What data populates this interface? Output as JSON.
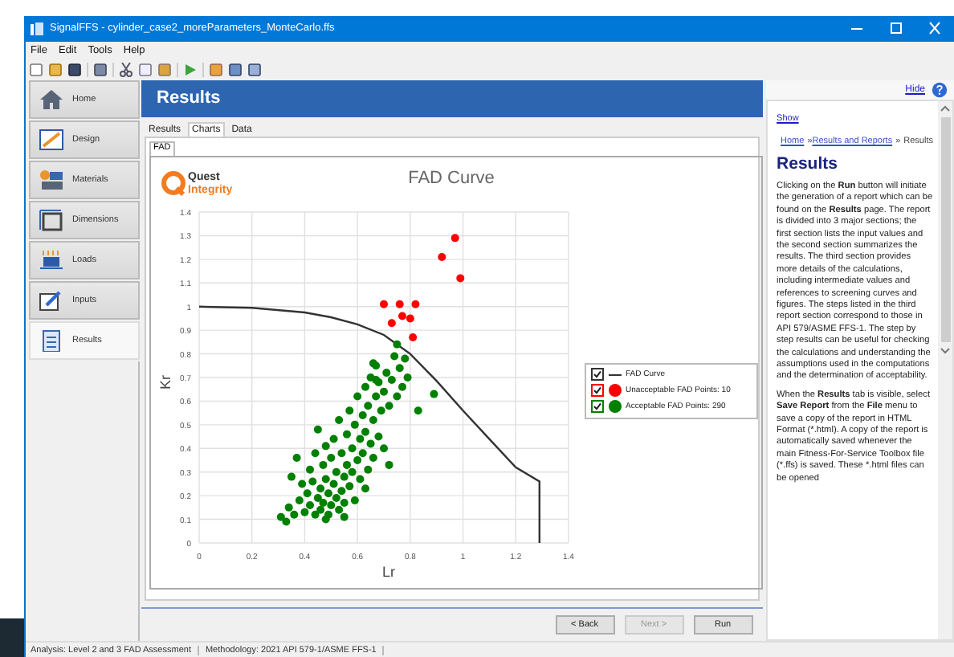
{
  "window": {
    "title": "SignalFFS  -  cylinder_case2_moreParameters_MonteCarlo.ffs"
  },
  "menu": [
    "File",
    "Edit",
    "Tools",
    "Help"
  ],
  "toolbar": [
    {
      "kind": "new"
    },
    {
      "kind": "open"
    },
    {
      "kind": "save"
    },
    {
      "kind": "sep"
    },
    {
      "kind": "print"
    },
    {
      "kind": "sep"
    },
    {
      "kind": "cut"
    },
    {
      "kind": "copy"
    },
    {
      "kind": "paste"
    },
    {
      "kind": "sep"
    },
    {
      "kind": "run"
    },
    {
      "kind": "sep"
    },
    {
      "kind": "report"
    },
    {
      "kind": "chart"
    },
    {
      "kind": "preview"
    }
  ],
  "sidebar": {
    "items": [
      {
        "label": "Home",
        "kind": "home",
        "selected": false
      },
      {
        "label": "Design",
        "kind": "design",
        "selected": false
      },
      {
        "label": "Materials",
        "kind": "materials",
        "selected": false
      },
      {
        "label": "Dimensions",
        "kind": "dimensions",
        "selected": false
      },
      {
        "label": "Loads",
        "kind": "loads",
        "selected": false
      },
      {
        "label": "Inputs",
        "kind": "inputs",
        "selected": false
      },
      {
        "label": "Results",
        "kind": "results",
        "selected": true
      }
    ]
  },
  "page": {
    "title": "Results",
    "tabs": [
      {
        "label": "Results",
        "selected": false
      },
      {
        "label": "Charts",
        "selected": true
      },
      {
        "label": "Data",
        "selected": false
      }
    ],
    "subtabs": [
      {
        "label": "FAD",
        "selected": true
      }
    ],
    "logo": {
      "line1": "Quest",
      "line2": "Integrity"
    },
    "chart_data": {
      "type": "scatter",
      "grid": true,
      "legend": "right",
      "title": "FAD Curve",
      "xlabel": "Lr",
      "ylabel": "Kr",
      "xlim": [
        0,
        1.4
      ],
      "ylim": [
        0,
        1.4
      ],
      "xticks": [
        0,
        0.2,
        0.4,
        0.6,
        0.8,
        1,
        1.2,
        1.4
      ],
      "yticks": [
        0,
        0.1,
        0.2,
        0.3,
        0.4,
        0.5,
        0.6,
        0.7,
        0.8,
        0.9,
        1,
        1.1,
        1.2,
        1.3,
        1.4
      ],
      "series": [
        {
          "name": "FAD Curve",
          "type": "line",
          "color": "#333333",
          "x": [
            0,
            0.2,
            0.4,
            0.5,
            0.6,
            0.7,
            0.8,
            0.9,
            1,
            1.1,
            1.2,
            1.29,
            1.29
          ],
          "values": [
            1,
            0.995,
            0.975,
            0.955,
            0.925,
            0.88,
            0.8,
            0.685,
            0.56,
            0.44,
            0.32,
            0.26,
            0
          ]
        },
        {
          "name": "Unacceptable FAD Points: 10",
          "color": "#ff0000",
          "x": [
            0.7,
            0.76,
            0.82,
            0.73,
            0.77,
            0.8,
            0.81,
            0.92,
            0.97,
            0.99
          ],
          "values": [
            1.01,
            1.01,
            1.01,
            0.93,
            0.96,
            0.95,
            0.87,
            1.21,
            1.29,
            1.12
          ]
        },
        {
          "name": "Acceptable FAD Points: 290",
          "color": "#008000",
          "x": [
            0.31,
            0.33,
            0.34,
            0.36,
            0.35,
            0.37,
            0.38,
            0.39,
            0.4,
            0.41,
            0.42,
            0.42,
            0.43,
            0.44,
            0.44,
            0.45,
            0.45,
            0.46,
            0.46,
            0.47,
            0.47,
            0.48,
            0.48,
            0.49,
            0.49,
            0.5,
            0.5,
            0.51,
            0.51,
            0.52,
            0.52,
            0.53,
            0.53,
            0.54,
            0.54,
            0.55,
            0.55,
            0.56,
            0.56,
            0.57,
            0.57,
            0.58,
            0.58,
            0.59,
            0.59,
            0.6,
            0.6,
            0.61,
            0.61,
            0.62,
            0.62,
            0.63,
            0.63,
            0.64,
            0.64,
            0.65,
            0.65,
            0.66,
            0.66,
            0.67,
            0.67,
            0.68,
            0.68,
            0.69,
            0.7,
            0.7,
            0.71,
            0.72,
            0.72,
            0.73,
            0.74,
            0.75,
            0.75,
            0.76,
            0.77,
            0.78,
            0.79,
            0.83,
            0.89,
            0.66,
            0.67,
            0.55,
            0.48,
            0.63
          ],
          "values": [
            0.11,
            0.09,
            0.15,
            0.12,
            0.28,
            0.36,
            0.18,
            0.25,
            0.13,
            0.21,
            0.31,
            0.16,
            0.26,
            0.12,
            0.38,
            0.19,
            0.48,
            0.23,
            0.14,
            0.33,
            0.17,
            0.27,
            0.41,
            0.12,
            0.21,
            0.16,
            0.36,
            0.25,
            0.44,
            0.19,
            0.3,
            0.14,
            0.52,
            0.22,
            0.38,
            0.28,
            0.17,
            0.46,
            0.33,
            0.24,
            0.56,
            0.4,
            0.3,
            0.18,
            0.5,
            0.35,
            0.62,
            0.44,
            0.27,
            0.54,
            0.38,
            0.66,
            0.47,
            0.31,
            0.58,
            0.42,
            0.7,
            0.52,
            0.36,
            0.62,
            0.75,
            0.45,
            0.68,
            0.56,
            0.64,
            0.4,
            0.72,
            0.33,
            0.58,
            0.69,
            0.79,
            0.62,
            0.84,
            0.74,
            0.66,
            0.78,
            0.7,
            0.56,
            0.63,
            0.76,
            0.69,
            0.11,
            0.1,
            0.23
          ]
        }
      ]
    },
    "legend": [
      {
        "checked": true
      },
      {
        "checked": true
      },
      {
        "checked": true
      }
    ],
    "buttons": [
      {
        "label": "< Back",
        "disabled": false
      },
      {
        "label": "Next >",
        "disabled": true
      },
      {
        "label": "Run",
        "disabled": false
      }
    ]
  },
  "help": {
    "hide_link": "Hide",
    "show_link": "Show",
    "breadcrumb": [
      "Home",
      "Results and Reports",
      "Results"
    ],
    "separator": "»",
    "title": "Results",
    "paragraphs": [
      [
        {
          "text": "Clicking on the "
        },
        {
          "text": "Run",
          "bold": true
        },
        {
          "text": " button will initiate the generation of a report which can be found on the "
        },
        {
          "text": "Results",
          "bold": true
        },
        {
          "text": " page. The report is divided into 3 major sections; the first section lists the input values and the second section summarizes the results. The third section provides more details of the calculations, including intermediate values and references to screening curves and figures. The steps listed in the third report section correspond to those in API 579/ASME FFS-1. The step by step results can be useful for checking the calculations and understanding the assumptions used in the computations and the determination of acceptability."
        }
      ],
      [
        {
          "text": "When the "
        },
        {
          "text": "Results",
          "bold": true
        },
        {
          "text": " tab is visible, select "
        },
        {
          "text": "Save Report",
          "bold": true
        },
        {
          "text": " from the "
        },
        {
          "text": "File",
          "bold": true
        },
        {
          "text": " menu to save a copy of the report in HTML Format (*.html). A copy of the report is automatically saved whenever the main Fitness-For-Service Toolbox file (*.ffs) is saved. These *.html files can be opened"
        }
      ]
    ]
  },
  "status_bar": [
    "Analysis: Level 2 and 3 FAD Assessment",
    "Methodology: 2021 API 579-1/ASME FFS-1"
  ]
}
